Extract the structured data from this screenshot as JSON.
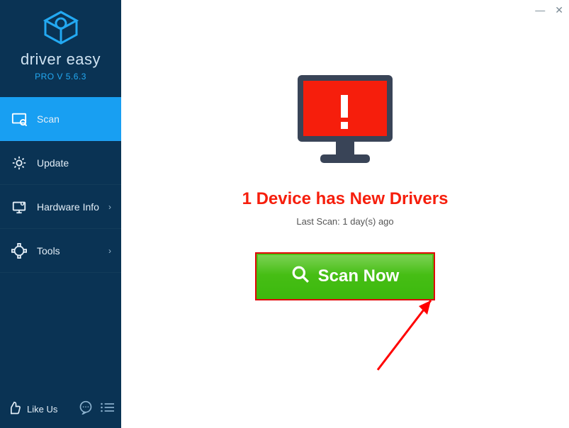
{
  "brand": {
    "name_left": "driver ",
    "name_right": "easy",
    "version_label": "PRO V 5.6.3"
  },
  "sidebar": {
    "items": [
      {
        "label": "Scan",
        "icon": "scan-icon",
        "active": true,
        "has_children": false
      },
      {
        "label": "Update",
        "icon": "update-icon",
        "active": false,
        "has_children": false
      },
      {
        "label": "Hardware Info",
        "icon": "hardware-icon",
        "active": false,
        "has_children": true
      },
      {
        "label": "Tools",
        "icon": "tools-icon",
        "active": false,
        "has_children": true
      }
    ],
    "like_us_label": "Like Us"
  },
  "main": {
    "monitor_state": "alert",
    "headline": "1 Device has New Drivers",
    "last_scan_label": "Last Scan: 1 day(s) ago",
    "scan_button_label": "Scan Now"
  },
  "window": {
    "minimize_glyph": "—",
    "close_glyph": "✕"
  },
  "colors": {
    "sidebar_bg": "#0a3354",
    "active_nav": "#189ff2",
    "alert_red": "#f61e0c",
    "button_green": "#3cb90e",
    "button_border": "#e00606"
  }
}
